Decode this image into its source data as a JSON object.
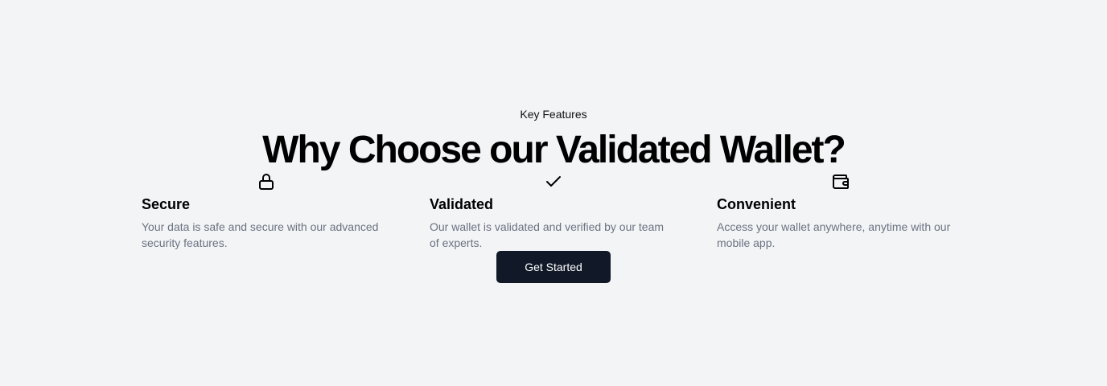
{
  "section": {
    "eyebrow": "Key Features",
    "headline": "Why Choose our Validated Wallet?"
  },
  "features": [
    {
      "icon": "lock-icon",
      "title": "Secure",
      "description": "Your data is safe and secure with our advanced security features."
    },
    {
      "icon": "check-icon",
      "title": "Validated",
      "description": "Our wallet is validated and verified by our team of experts."
    },
    {
      "icon": "wallet-icon",
      "title": "Convenient",
      "description": "Access your wallet anywhere, anytime with our mobile app."
    }
  ],
  "cta": {
    "label": "Get Started"
  },
  "colors": {
    "background": "#f3f4f6",
    "button": "#111827",
    "muted_text": "#6b7280"
  }
}
